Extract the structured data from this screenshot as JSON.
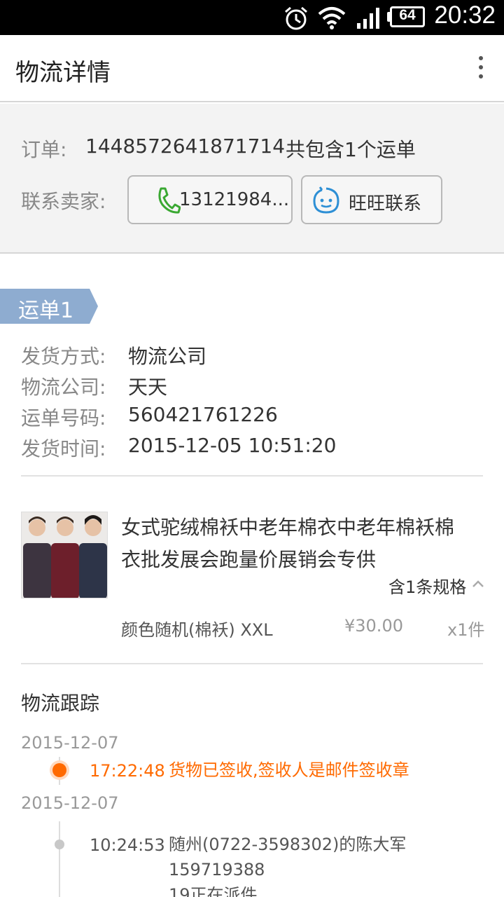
{
  "status_bar": {
    "battery": "64",
    "time": "20:32",
    "icons": [
      "alarm-clock-icon",
      "wifi-icon",
      "signal-icon",
      "battery-icon"
    ]
  },
  "header": {
    "title": "物流详情",
    "menu_icon": "more-vertical-icon"
  },
  "order": {
    "label": "订单:",
    "number": "1448572641871714",
    "summary": "共包含1个运单",
    "contact_label": "联系卖家:",
    "phone_button": "13121984...",
    "wangwang_button": "旺旺联系"
  },
  "waybill": {
    "tag": "运单1",
    "rows": [
      {
        "label": "发货方式:",
        "value": "物流公司"
      },
      {
        "label": "物流公司:",
        "value": "天天"
      },
      {
        "label": "运单号码:",
        "value": "560421761226"
      },
      {
        "label": "发货时间:",
        "value": "2015-12-05 10:51:20"
      }
    ]
  },
  "product": {
    "name_line1": "女式驼绒棉袄中老年棉衣中老年棉袄棉",
    "name_line2": "衣批发展会跑量价展销会专供",
    "spec_count": "含1条规格",
    "sku": "颜色随机(棉袄) XXL",
    "price": "¥30.00",
    "quantity": "x1件"
  },
  "tracking": {
    "title": "物流跟踪",
    "events": [
      {
        "date": "2015-12-07",
        "time": "17:22:48",
        "text_line1": "货物已签收,签收人是邮件签收章",
        "text_line2": ""
      },
      {
        "date": "2015-12-07",
        "time": "10:24:53",
        "text_line1": "随州(0722-3598302)的陈大军159719388",
        "text_line2": "19正在派件"
      }
    ]
  },
  "colors": {
    "accent": "#ff6a00",
    "tag_blue": "#8eacd0",
    "status_bar": "#000000"
  }
}
